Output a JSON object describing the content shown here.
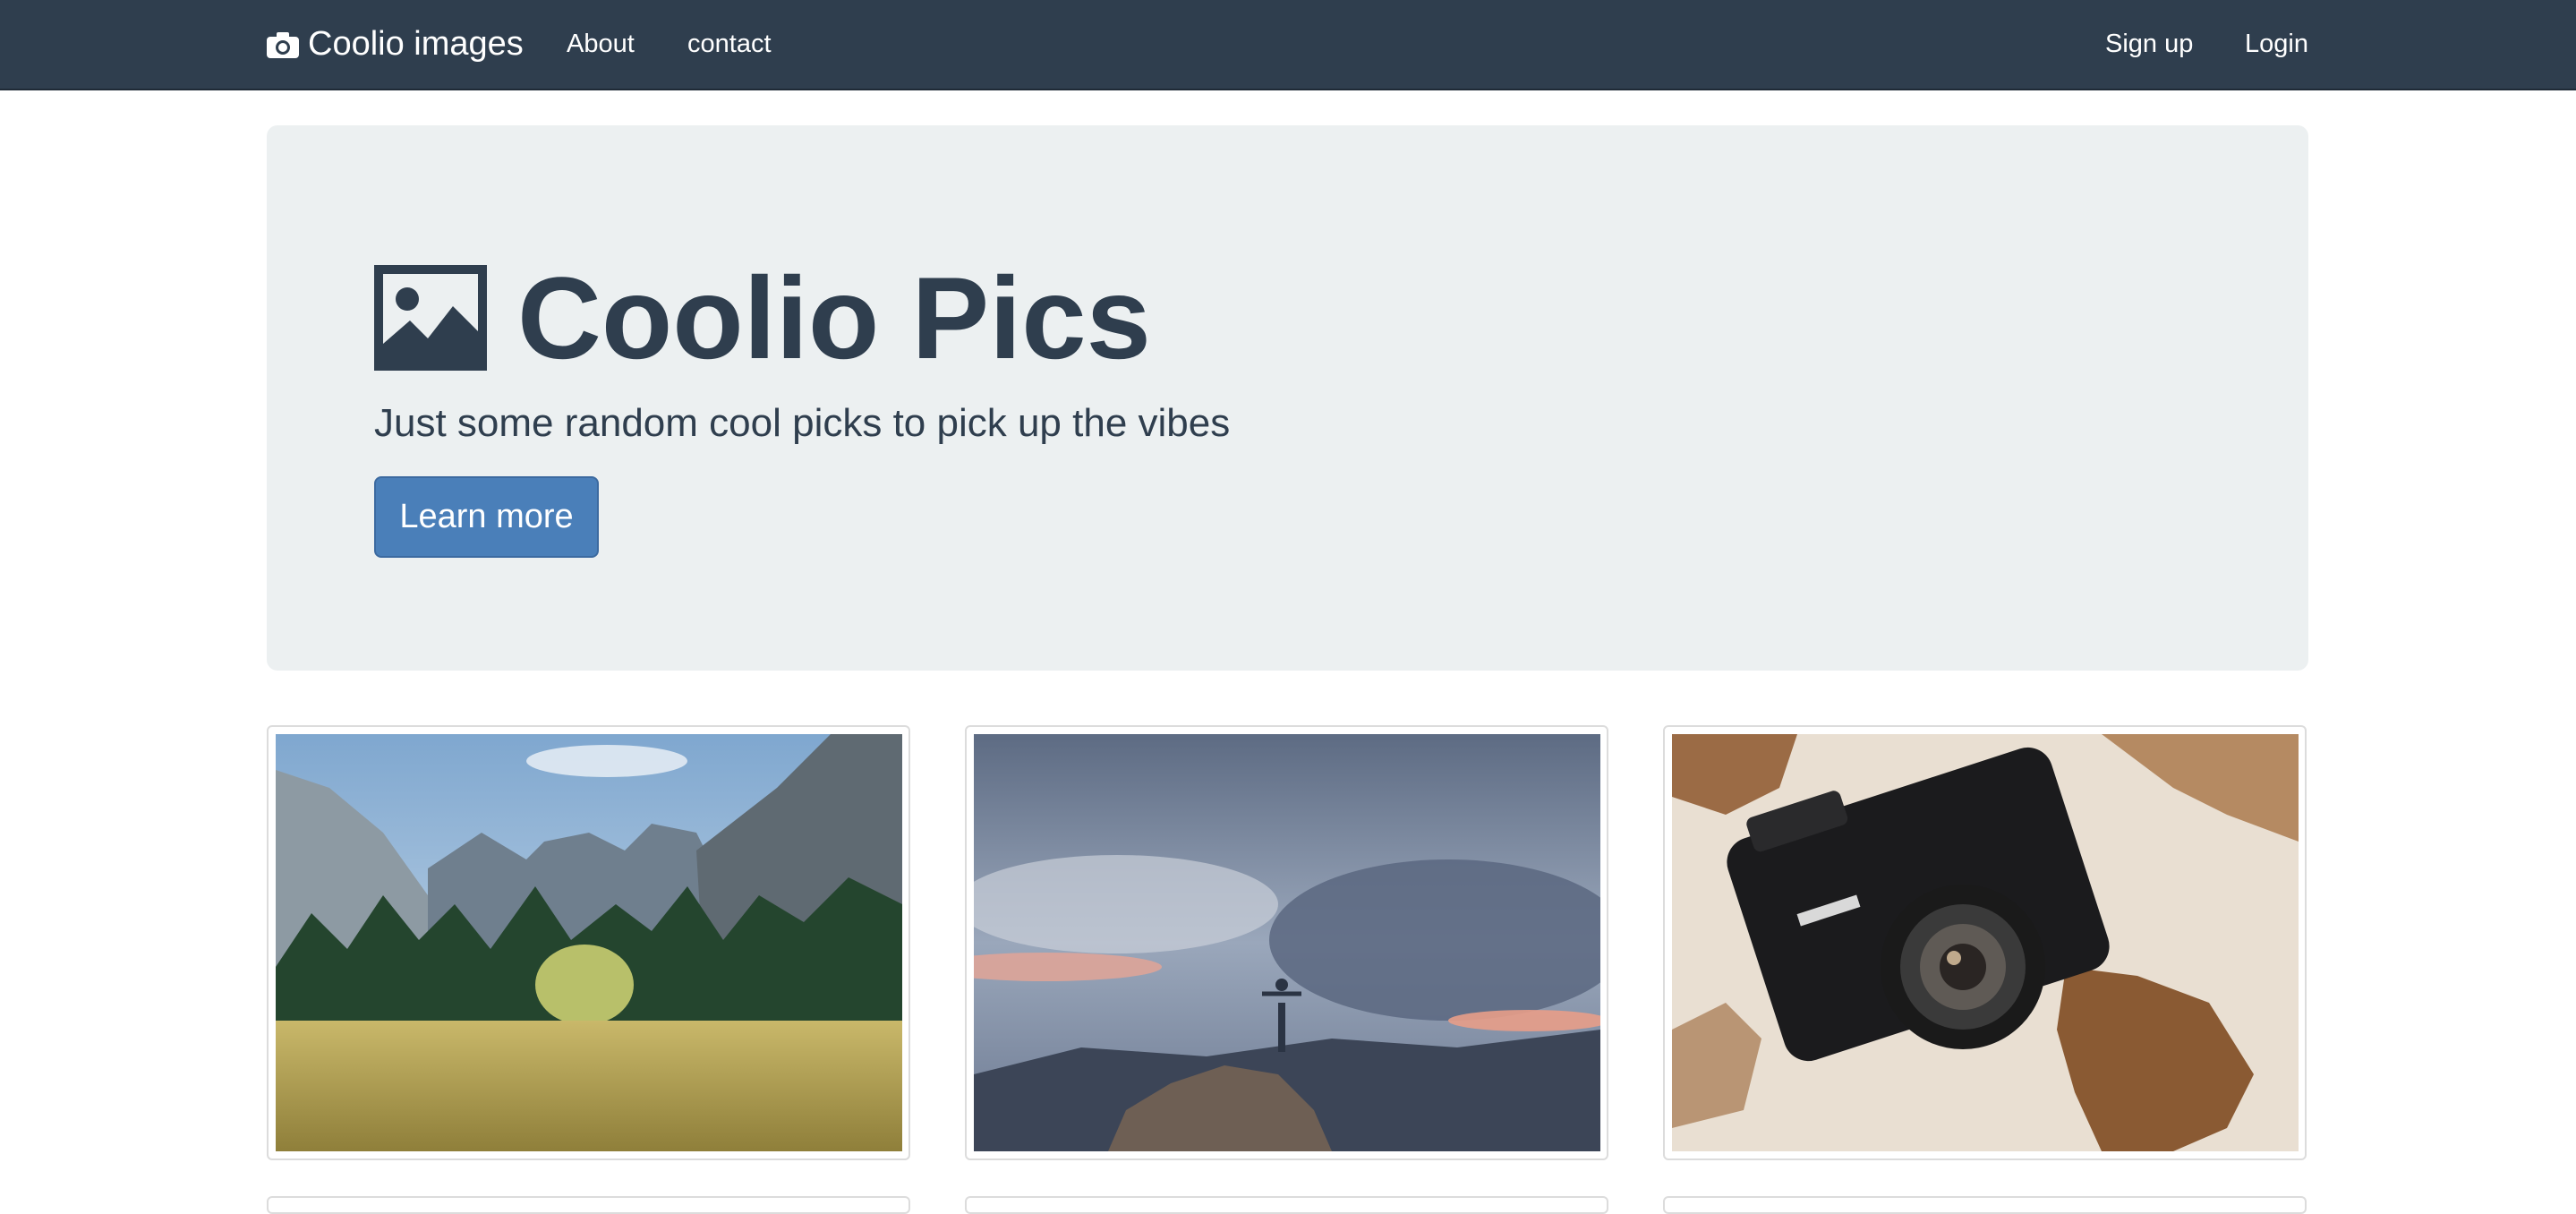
{
  "navbar": {
    "brand": "Coolio images",
    "links": [
      "About",
      "contact"
    ],
    "right_links": [
      "Sign up",
      "Login"
    ]
  },
  "jumbotron": {
    "title": "Coolio Pics",
    "subtitle": "Just some random cool picks to pick up the vibes",
    "button_label": "Learn more"
  },
  "icons": {
    "brand": "camera-icon",
    "title": "picture-icon"
  },
  "gallery": {
    "images": [
      "mountain-valley-meadow",
      "person-on-rock-at-sunset",
      "konica-camera-on-world-map"
    ]
  },
  "colors": {
    "navbar": "#2f3e4e",
    "jumbotron": "#ecf0f1",
    "primary_button": "#4a7fb9",
    "text_dark": "#2f3e4e"
  }
}
